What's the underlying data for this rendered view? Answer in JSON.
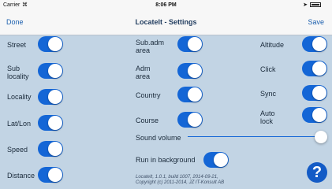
{
  "status": {
    "carrier": "Carrier",
    "wifi_icon": "wifi-icon",
    "time": "8:06 PM"
  },
  "nav": {
    "done": "Done",
    "title": "LocateIt - Settings",
    "save": "Save"
  },
  "toggles": {
    "street": {
      "label": "Street",
      "on": true
    },
    "sub_locality": {
      "label": "Sub\nlocality",
      "on": true
    },
    "locality": {
      "label": "Locality",
      "on": true
    },
    "latlon": {
      "label": "Lat/Lon",
      "on": true
    },
    "speed": {
      "label": "Speed",
      "on": true
    },
    "distance": {
      "label": "Distance",
      "on": true
    },
    "sub_adm_area": {
      "label": "Sub.adm\narea",
      "on": true
    },
    "adm_area": {
      "label": "Adm\narea",
      "on": true
    },
    "country": {
      "label": "Country",
      "on": true
    },
    "course": {
      "label": "Course",
      "on": true
    },
    "altitude": {
      "label": "Altitude",
      "on": true
    },
    "click": {
      "label": "Click",
      "on": true
    },
    "sync": {
      "label": "Sync",
      "on": true
    },
    "auto_lock": {
      "label": "Auto\nlock",
      "on": true
    },
    "run_in_background": {
      "label": "Run in background",
      "on": true
    }
  },
  "sound_volume": {
    "label": "Sound volume",
    "value": 1.0
  },
  "info": {
    "line1": "LocateIt, 1.0.1, build 1007, 2014-09-21,",
    "line2": "Copyright (c) 2011-2014, JZ IT-Konsult AB"
  },
  "help": {
    "label": "?"
  },
  "colors": {
    "accent": "#1466d6",
    "background": "#c2d4e4"
  }
}
